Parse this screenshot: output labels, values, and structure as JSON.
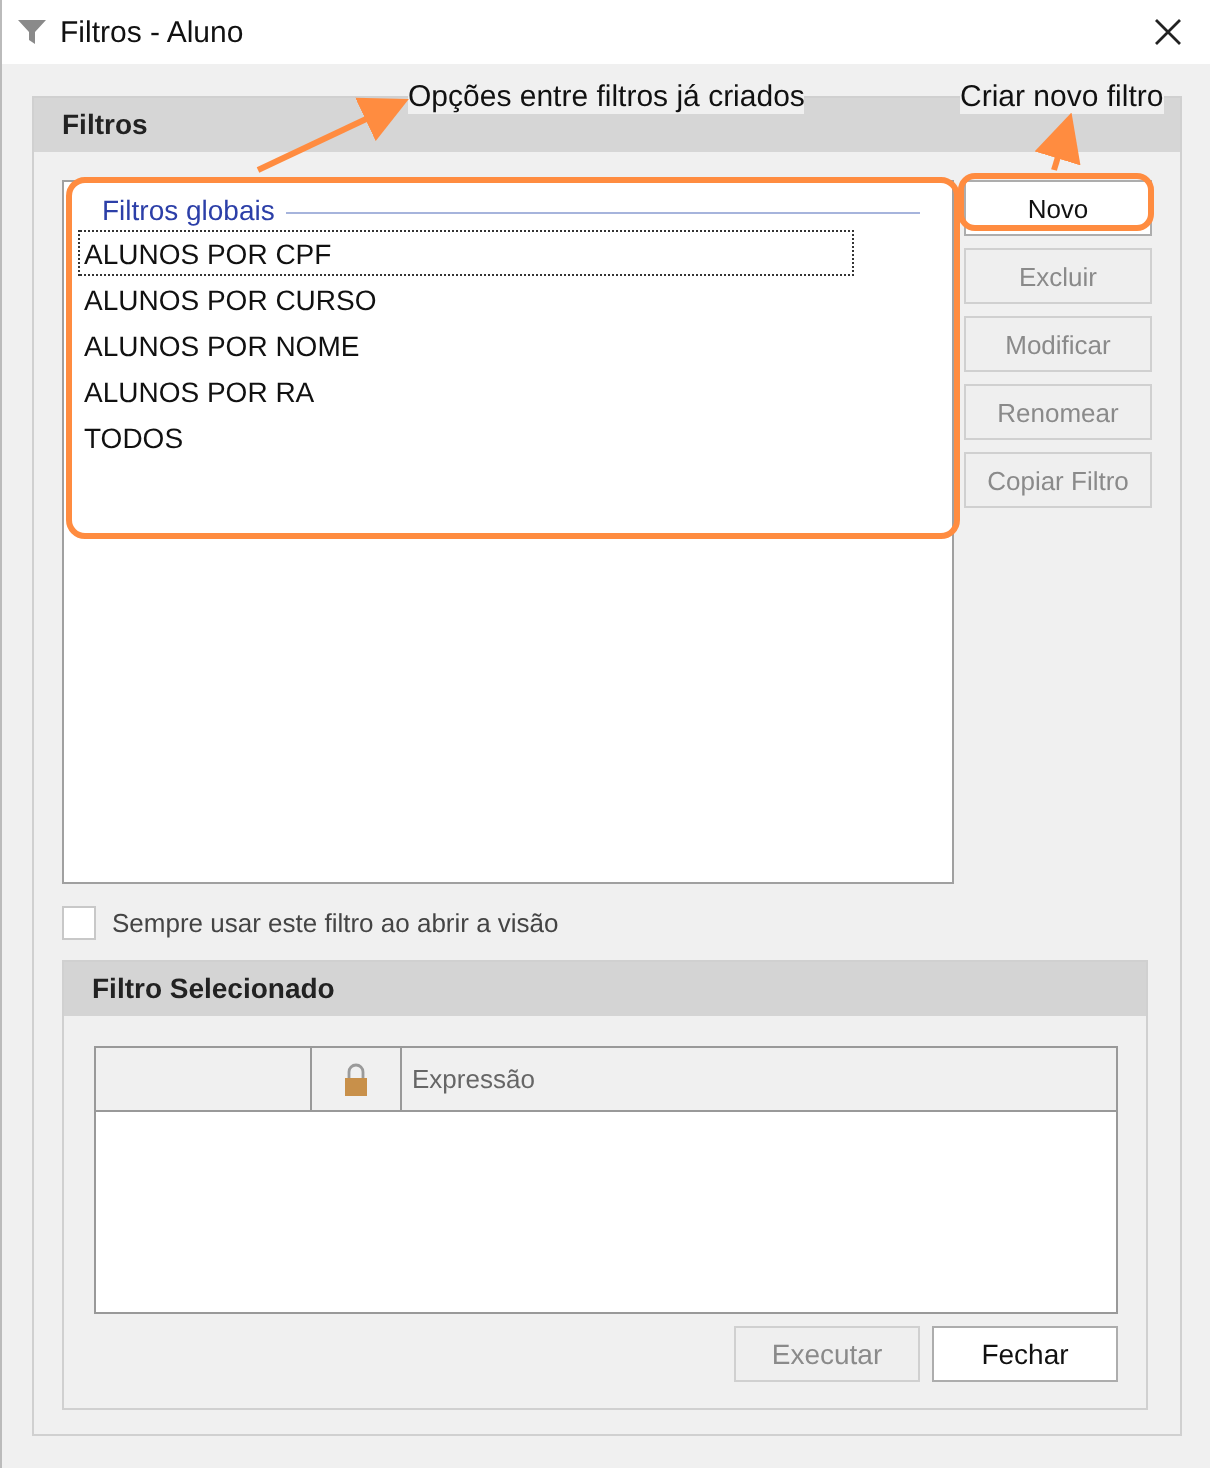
{
  "window": {
    "title": "Filtros - Aluno"
  },
  "annotations": [
    {
      "text": "Opções entre filtros já criados"
    },
    {
      "text": "Criar novo filtro"
    }
  ],
  "filters_group": {
    "title": "Filtros",
    "list": {
      "section": "Filtros globais",
      "items": [
        {
          "label": "ALUNOS POR CPF",
          "selected": true
        },
        {
          "label": "ALUNOS POR CURSO",
          "selected": false
        },
        {
          "label": "ALUNOS POR NOME",
          "selected": false
        },
        {
          "label": "ALUNOS POR RA",
          "selected": false
        },
        {
          "label": "TODOS",
          "selected": false
        }
      ]
    },
    "buttons": [
      {
        "label": "Novo",
        "disabled": false
      },
      {
        "label": "Excluir",
        "disabled": true
      },
      {
        "label": "Modificar",
        "disabled": true
      },
      {
        "label": "Renomear",
        "disabled": true
      },
      {
        "label": "Copiar Filtro",
        "disabled": true
      }
    ],
    "checkbox": {
      "label": "Sempre usar este filtro ao abrir a visão",
      "checked": false
    }
  },
  "selected_group": {
    "title": "Filtro Selecionado",
    "table": {
      "columns": [
        {
          "kind": "blank"
        },
        {
          "kind": "lock"
        },
        {
          "label": "Expressão",
          "kind": "text"
        }
      ]
    },
    "buttons": [
      {
        "label": "Executar",
        "disabled": true
      },
      {
        "label": "Fechar",
        "disabled": false
      }
    ]
  }
}
